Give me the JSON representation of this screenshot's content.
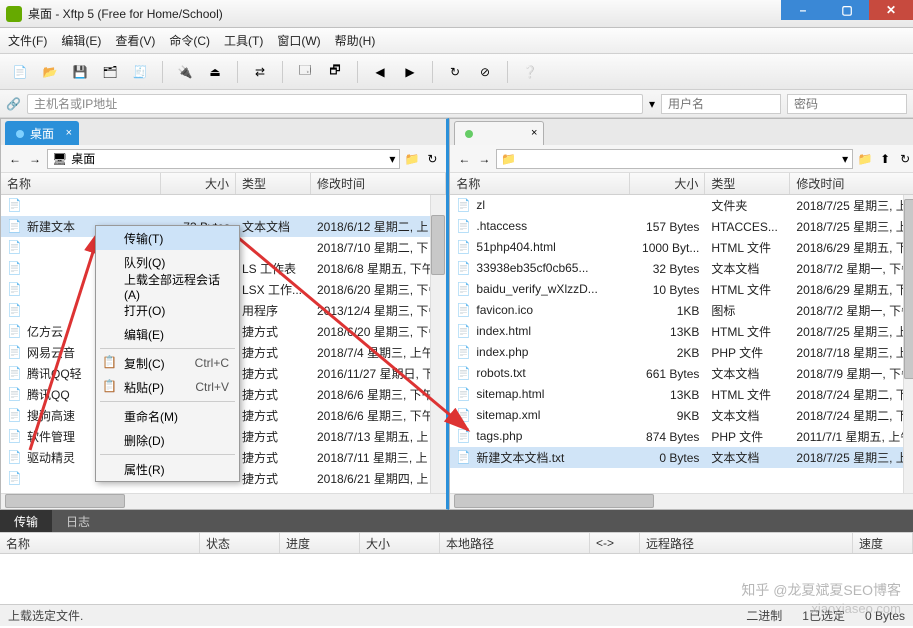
{
  "window": {
    "title": "桌面 - Xftp 5 (Free for Home/School)"
  },
  "menubar": [
    "文件(F)",
    "编辑(E)",
    "查看(V)",
    "命令(C)",
    "工具(T)",
    "窗口(W)",
    "帮助(H)"
  ],
  "address": {
    "placeholder": "主机名或IP地址",
    "user_ph": "用户名",
    "pass_ph": "密码"
  },
  "left": {
    "tab": "桌面",
    "path_label": "桌面",
    "columns": [
      "名称",
      "大小",
      "类型",
      "修改时间"
    ],
    "rows": [
      {
        "name": "",
        "size": "",
        "type": "",
        "date": ""
      },
      {
        "name": "新建文本",
        "size": "73 Bytes",
        "type": "文本文档",
        "date": "2018/6/12 星期二, 上"
      },
      {
        "name": "",
        "size": "",
        "type": "",
        "date": "2018/7/10 星期二, 下"
      },
      {
        "name": "",
        "size": "",
        "type": "LS 工作表",
        "date": "2018/6/8 星期五, 下午"
      },
      {
        "name": "",
        "size": "",
        "type": "LSX 工作...",
        "date": "2018/6/20 星期三, 下午"
      },
      {
        "name": "",
        "size": "",
        "type": "用程序",
        "date": "2013/12/4 星期三, 下午"
      },
      {
        "name": "亿方云",
        "size": "",
        "type": "捷方式",
        "date": "2018/6/20 星期三, 下午"
      },
      {
        "name": "网易云音",
        "size": "",
        "type": "捷方式",
        "date": "2018/7/4 星期三, 上午"
      },
      {
        "name": "腾讯QQ轻",
        "size": "",
        "type": "捷方式",
        "date": "2016/11/27 星期日, 下"
      },
      {
        "name": "腾讯QQ",
        "size": "",
        "type": "捷方式",
        "date": "2018/6/6 星期三, 下午"
      },
      {
        "name": "搜狗高速",
        "size": "",
        "type": "捷方式",
        "date": "2018/6/6 星期三, 下午"
      },
      {
        "name": "软件管理",
        "size": "",
        "type": "捷方式",
        "date": "2018/7/13 星期五, 上"
      },
      {
        "name": "驱动精灵",
        "size": "",
        "type": "捷方式",
        "date": "2018/7/11 星期三, 上"
      },
      {
        "name": "",
        "size": "",
        "type": "捷方式",
        "date": "2018/6/21 星期四, 上"
      }
    ]
  },
  "right": {
    "tab": "",
    "columns": [
      "名称",
      "大小",
      "类型",
      "修改时间"
    ],
    "rows": [
      {
        "name": "zl",
        "size": "",
        "type": "文件夹",
        "date": "2018/7/25 星期三, 上"
      },
      {
        "name": ".htaccess",
        "size": "157 Bytes",
        "type": "HTACCES...",
        "date": "2018/7/25 星期三, 上"
      },
      {
        "name": "51php404.html",
        "size": "1000 Byt...",
        "type": "HTML 文件",
        "date": "2018/6/29 星期五, 下"
      },
      {
        "name": "33938eb35cf0cb65...",
        "size": "32 Bytes",
        "type": "文本文档",
        "date": "2018/7/2 星期一, 下午"
      },
      {
        "name": "baidu_verify_wXlzzD...",
        "size": "10 Bytes",
        "type": "HTML 文件",
        "date": "2018/6/29 星期五, 下"
      },
      {
        "name": "favicon.ico",
        "size": "1KB",
        "type": "图标",
        "date": "2018/7/2 星期一, 下午"
      },
      {
        "name": "index.html",
        "size": "13KB",
        "type": "HTML 文件",
        "date": "2018/7/25 星期三, 上"
      },
      {
        "name": "index.php",
        "size": "2KB",
        "type": "PHP 文件",
        "date": "2018/7/18 星期三, 上"
      },
      {
        "name": "robots.txt",
        "size": "661 Bytes",
        "type": "文本文档",
        "date": "2018/7/9 星期一, 下午"
      },
      {
        "name": "sitemap.html",
        "size": "13KB",
        "type": "HTML 文件",
        "date": "2018/7/24 星期二, 下"
      },
      {
        "name": "sitemap.xml",
        "size": "9KB",
        "type": "文本文档",
        "date": "2018/7/24 星期二, 下"
      },
      {
        "name": "tags.php",
        "size": "874 Bytes",
        "type": "PHP 文件",
        "date": "2011/7/1 星期五, 上午"
      },
      {
        "name": "新建文本文档.txt",
        "size": "0 Bytes",
        "type": "文本文档",
        "date": "2018/7/25 星期三, 上"
      }
    ]
  },
  "context_menu": [
    {
      "label": "传输(T)",
      "sel": true
    },
    {
      "label": "队列(Q)"
    },
    {
      "label": "上载全部远程会话(A)"
    },
    {
      "label": "打开(O)"
    },
    {
      "label": "编辑(E)"
    },
    {
      "sep": true
    },
    {
      "label": "复制(C)",
      "sc": "Ctrl+C",
      "icon": "copy"
    },
    {
      "label": "粘贴(P)",
      "sc": "Ctrl+V",
      "icon": "paste"
    },
    {
      "sep": true
    },
    {
      "label": "重命名(M)"
    },
    {
      "label": "删除(D)"
    },
    {
      "sep": true
    },
    {
      "label": "属性(R)"
    }
  ],
  "bottom_tabs": [
    "传输",
    "日志"
  ],
  "xfer_columns": [
    "名称",
    "状态",
    "进度",
    "大小",
    "本地路径",
    "<->",
    "远程路径",
    "速度"
  ],
  "status": {
    "left": "上载选定文件.",
    "mid1": "二进制",
    "mid2": "1已选定",
    "right": "0 Bytes"
  },
  "watermark1": "知乎 @龙夏斌夏SEO博客",
  "watermark2": "xiaoxiaseo.com"
}
